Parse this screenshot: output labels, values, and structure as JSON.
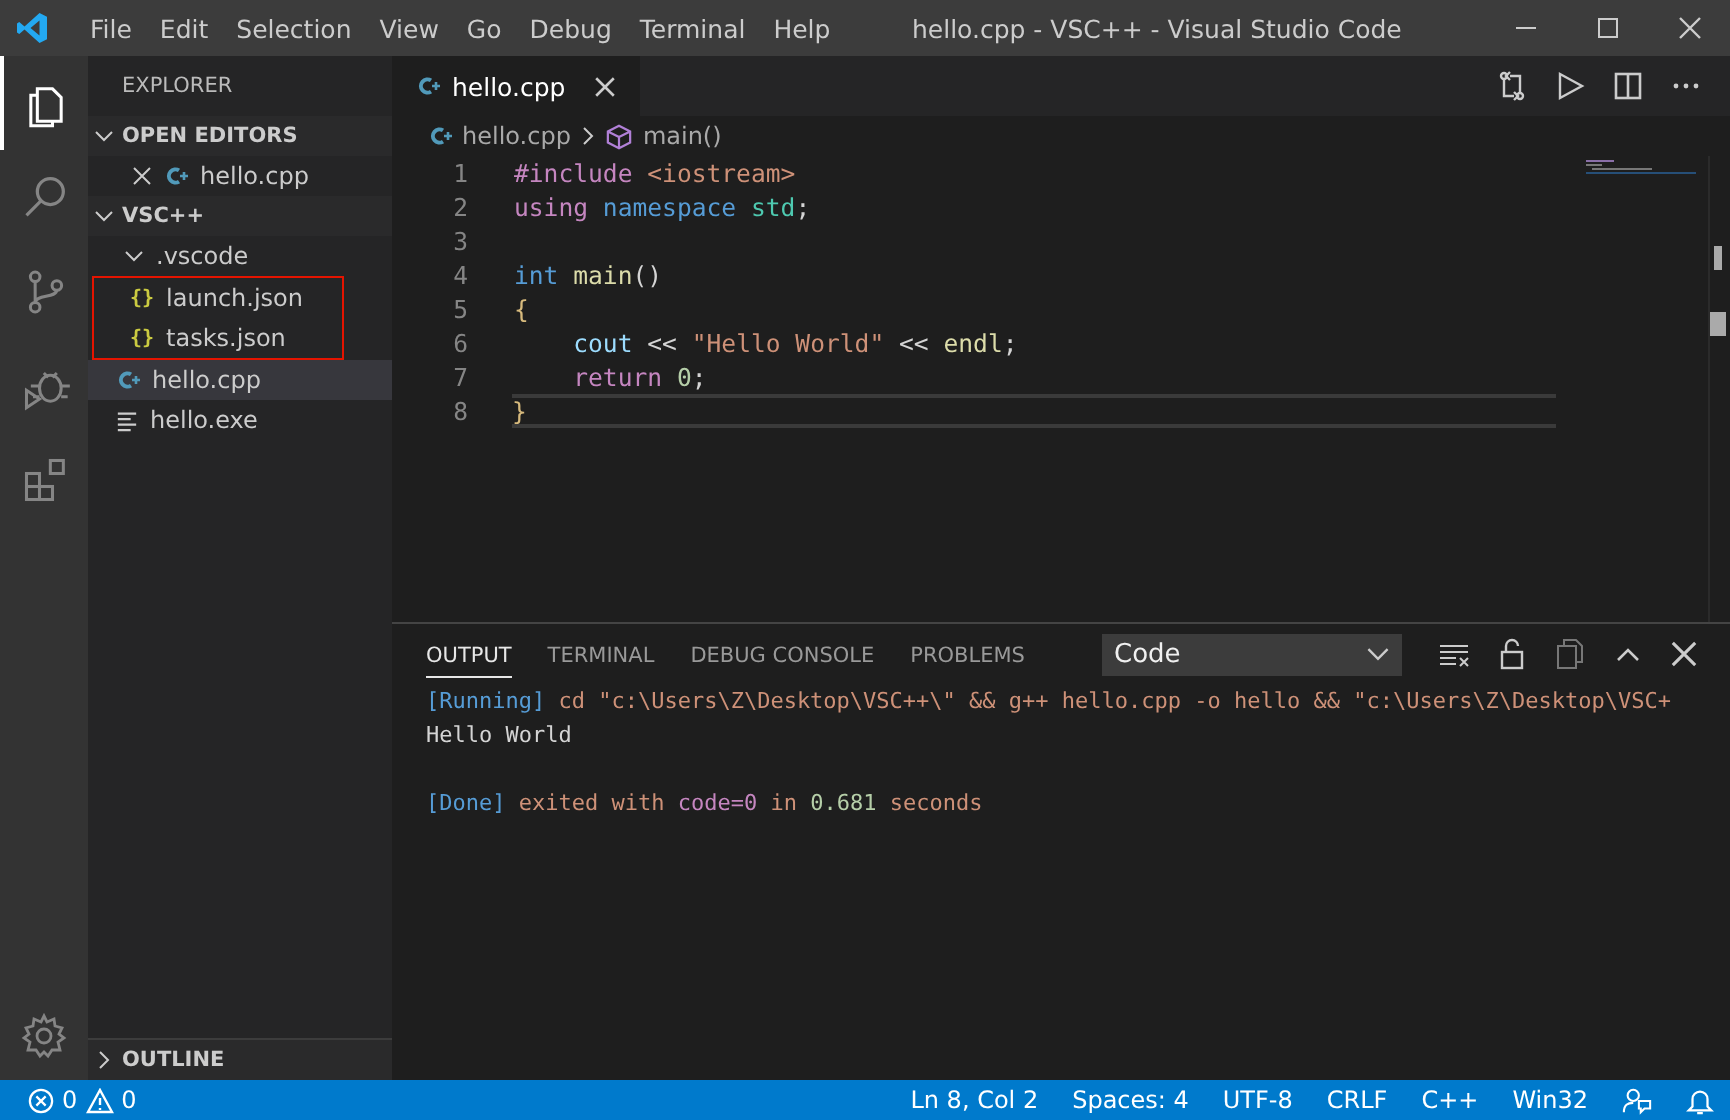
{
  "window": {
    "title": "hello.cpp - VSC++ - Visual Studio Code"
  },
  "menu": [
    "File",
    "Edit",
    "Selection",
    "View",
    "Go",
    "Debug",
    "Terminal",
    "Help"
  ],
  "activity_bar": [
    {
      "kind": "files",
      "selected": true
    },
    {
      "kind": "search",
      "selected": false
    },
    {
      "kind": "scm",
      "selected": false
    },
    {
      "kind": "debug",
      "selected": false
    },
    {
      "kind": "extensions",
      "selected": false
    }
  ],
  "sidebar": {
    "title": "EXPLORER",
    "open_editors": {
      "title": "OPEN EDITORS",
      "expanded": true,
      "items": [
        {
          "name": "hello.cpp",
          "kind": "cpp"
        }
      ]
    },
    "folder": {
      "title": "VSC++",
      "expanded": true,
      "items": [
        {
          "name": ".vscode",
          "kind": "folder",
          "expanded": true,
          "outlined_children": true,
          "selected": false,
          "children": [
            {
              "name": "launch.json",
              "kind": "json",
              "icon": "{}",
              "selected": false
            },
            {
              "name": "tasks.json",
              "kind": "json",
              "icon": "{}",
              "selected": false
            }
          ]
        },
        {
          "name": "hello.cpp",
          "kind": "cpp",
          "selected": true
        },
        {
          "name": "hello.exe",
          "kind": "file",
          "selected": false
        }
      ]
    },
    "outline": {
      "title": "OUTLINE",
      "expanded": false
    }
  },
  "tabs": [
    {
      "label": "hello.cpp",
      "selected": true
    }
  ],
  "breadcrumb": [
    {
      "label": "hello.cpp",
      "kind": "cpp"
    },
    {
      "label": "main()",
      "kind": "symbol"
    }
  ],
  "code": [
    {
      "number": "1",
      "current": false,
      "tokens": [
        {
          "t": "#include ",
          "kind": "control"
        },
        {
          "t": "<iostream>",
          "kind": "string"
        }
      ]
    },
    {
      "number": "2",
      "current": false,
      "tokens": [
        {
          "t": "using ",
          "kind": "control"
        },
        {
          "t": "namespace ",
          "kind": "keyword"
        },
        {
          "t": "std",
          "kind": "type"
        },
        {
          "t": ";"
        }
      ]
    },
    {
      "number": "3",
      "current": false
    },
    {
      "number": "4",
      "current": false,
      "tokens": [
        {
          "t": "int ",
          "kind": "keyword"
        },
        {
          "t": "main",
          "kind": "function"
        },
        {
          "t": "()"
        }
      ]
    },
    {
      "number": "5",
      "current": false,
      "tokens": [
        {
          "t": "{",
          "kind": "bracket"
        }
      ]
    },
    {
      "number": "6",
      "current": false,
      "tokens": [
        {
          "t": "    cout",
          "kind": "variable"
        },
        {
          "t": " << "
        },
        {
          "t": "\"Hello World\"",
          "kind": "string"
        },
        {
          "t": " << "
        },
        {
          "t": "endl",
          "kind": "function"
        },
        {
          "t": ";"
        }
      ]
    },
    {
      "number": "7",
      "current": false,
      "tokens": [
        {
          "t": "    return ",
          "kind": "control"
        },
        {
          "t": "0",
          "kind": "number"
        },
        {
          "t": ";"
        }
      ]
    },
    {
      "number": "8",
      "current": true,
      "tokens": [
        {
          "t": "}",
          "kind": "bracket"
        }
      ]
    }
  ],
  "panel": {
    "tabs": [
      {
        "label": "OUTPUT",
        "selected": true
      },
      {
        "label": "TERMINAL",
        "selected": false
      },
      {
        "label": "DEBUG CONSOLE",
        "selected": false
      },
      {
        "label": "PROBLEMS",
        "selected": false
      }
    ],
    "channel": "Code",
    "output_blocks": [
      {
        "lines": [
          {
            "tokens": [
              {
                "t": "[Running]",
                "kind": "tag"
              },
              {
                "t": " cd \"c:\\Users\\Z\\Desktop\\VSC++\\\" && g++ hello.cpp -o hello && \"c:\\Users\\Z\\Desktop\\VSC+",
                "kind": "string"
              }
            ]
          },
          {
            "tokens": [
              {
                "t": "Hello World"
              }
            ]
          }
        ]
      },
      {
        "lines": [
          {
            "tokens": [
              {
                "t": "[Done]",
                "kind": "tag"
              },
              {
                "t": " exited with ",
                "kind": "string"
              },
              {
                "t": "code=0",
                "kind": "control"
              },
              {
                "t": " in ",
                "kind": "string"
              },
              {
                "t": "0.681",
                "kind": "number"
              },
              {
                "t": " seconds",
                "kind": "string"
              }
            ]
          }
        ]
      }
    ]
  },
  "status_bar": {
    "errors": "0",
    "warnings": "0",
    "items": [
      "Ln 8, Col 2",
      "Spaces: 4",
      "UTF-8",
      "CRLF",
      "C++",
      "Win32"
    ]
  }
}
